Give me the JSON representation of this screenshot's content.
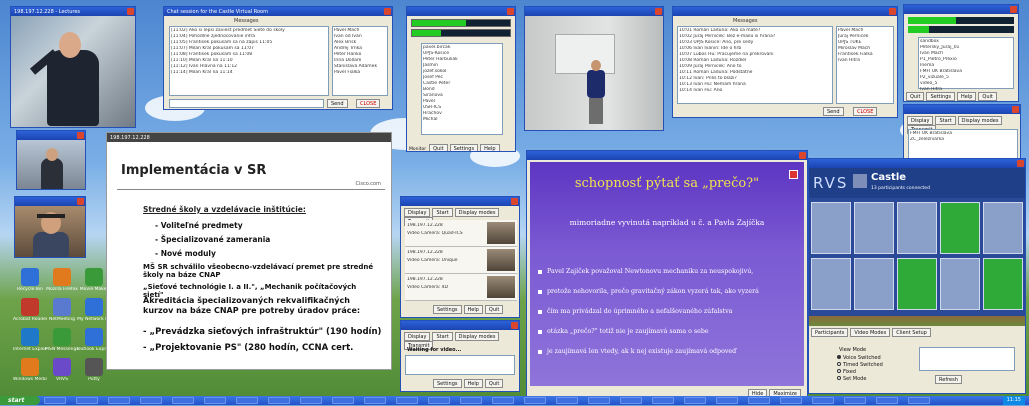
{
  "slide1": {
    "window_title": "198.197.12.228",
    "title": "Implementácia v SR",
    "brand": "Cisco.com",
    "heading1": "Stredné školy a vzdelávacie inštitúcie:",
    "bullets": [
      "- Voliteľné predmety",
      "- Špecializované zamerania",
      "- Nové moduly"
    ],
    "para1": "MŠ SR schválilo všeobecno-vzdelávací premet pre stredné školy na báze CNAP",
    "para2": "„Sieťové technológie I. a II.\", „Mechanik počítačových sietí\"",
    "para3": "Akreditácia špecializovaných rekvalifikačných kurzov na báze CNAP pre potreby úradov práce:",
    "course1": "- „Prevádzka sieťových infraštruktúr\" (190 hodín)",
    "course2": "- „Projektovanie PS\" (280 hodín, CCNA cert."
  },
  "slide2": {
    "title": "schopnosť pýtať sa „prečo?\"",
    "subtitle": "mimoriadne vyvinutá napríklad u č. a Pavla Zajíčka",
    "bullets": [
      "Pavel Zajíček považoval Newtonovu mechaniku za neuspokojivú,",
      "pretože nehovorila, prečo gravitačný zákon vyzerá tak, ako vyzerá",
      "čím ma privádzal do úprimného a nefalšovaného zúfalstva",
      "otázka „prečo?\" totiž nie je zaujímavá sama o sebe",
      "je zaujímavá len vtedy, ak k nej existuje zaujímavá odpoveď"
    ],
    "buttons": [
      "Hide",
      "Maximize"
    ]
  },
  "vrvs": {
    "logo": "RVS",
    "castle": "Castle",
    "participants": "13 participants connected",
    "tabs": [
      "Participants",
      "Video Modes",
      "Client Setup"
    ],
    "mode_label": "View Mode",
    "modes": [
      "Voice Switched",
      "Timed Switched",
      "Fixed",
      "Set Mode"
    ],
    "apply": "Refresh"
  },
  "chat": {
    "window_title": "Chat session for the Castle Virtual Room",
    "header": "Messages",
    "send": "Send",
    "close": "CLOSE",
    "messages": [
      "[11:02] Ako si lepsi zaviest predmet Siete do skoly",
      "[11:04] Pohodlne zjednocovanie infra",
      "[11:05] Frantisek pokusam sa na zapis 11:05",
      "[11:07] Milan Kral pokusam sa 11:07",
      "[11:08] Frantisek pokusam sa 11:08",
      "[11:10] Milan Kral na 11:10",
      "[11:12] Ivan Hlavna na 11:12",
      "[11:14] Milan Kral na 11:14"
    ],
    "people": [
      "Pavel Mach",
      "Ivan od Ivan",
      "Alex Brisk",
      "Andrej Trnka",
      "Peter Hanko",
      "Irina Dollam",
      "Stanislava Adamek",
      "Pavel Fialka"
    ]
  },
  "chat2": {
    "header": "Messages",
    "send": "Send",
    "close": "CLOSE",
    "messages": [
      "10:01 Roman Laduna: Ako sa mate?",
      "10:02 Juraj Pernicek: Bez e-mailu si hrana?",
      "10:03 UPJS Kosice: Ano, pre sedy",
      "10:06 Ivan Ivanin: Ide o hrb",
      "10:07 Lubos Hu: Pracujeme na prekrovani",
      "10:08 Roman Laduna: Rozdiel",
      "10:09 Juraj Pernicek: Ano to",
      "10:11 Roman Laduna: Podstatne",
      "10:12 Ivan: Prilis to blazi?",
      "10:13 Ivan Hu: Nemam hrana",
      "10:14 Ivan Hu: Ano"
    ],
    "people": [
      "Pavel Mach",
      "Juraj Pernicek",
      "UPJS TUKE",
      "Miroslav Mach",
      "Frantisek Fialka",
      "Ivan Hitra"
    ]
  },
  "list1": {
    "items": [
      "pavel.bircak",
      "UPJS-Kosice",
      "Peter Harbuliak",
      "Jasmin",
      "jozef.sokol",
      "Josef Pec",
      "Castle Peter",
      "Bond",
      "Siranova",
      "Pavel",
      "USR-ICS",
      "Hrachov",
      "Michal"
    ],
    "buttons": [
      "Quit",
      "Settings",
      "Help",
      "Quit"
    ],
    "checkbox": "Monitor"
  },
  "list2": {
    "items": [
      "sandbox",
      "Petersky_Juraj_01",
      "Ivan Mach",
      "P1_Pietro_Prexio",
      "Inema",
      "FMFI UK Bratislava",
      "P2_vizuale_5",
      "video_5",
      "Ivan Hitra"
    ],
    "buttons": [
      "Quit",
      "Settings",
      "Help",
      "Quit"
    ]
  },
  "panel": {
    "tabs": [
      "Display",
      "Start",
      "Display modes",
      "Transmit"
    ],
    "rows": [
      {
        "ip": "198.197.12.228",
        "info": "Video Camera: Quad-ICS"
      },
      {
        "ip": "198.197.12.228",
        "info": "Video Camera: Unique"
      },
      {
        "ip": "198.197.12.228",
        "info": "Video Camera: 4D"
      }
    ],
    "buttons": [
      "Settings",
      "Help",
      "Quit"
    ],
    "waiting": "Waiting for video..."
  },
  "panel2": {
    "items": [
      "FMFI UK Bratislava",
      "ZC_zelezniarka"
    ],
    "buttons": [
      "Settings",
      "Help",
      "Quit"
    ]
  },
  "misc": {
    "lecturer_title": "198.197.12.228 - Lectures"
  },
  "icons": [
    {
      "label": "Recycle Bin"
    },
    {
      "label": "Mozilla Firefox"
    },
    {
      "label": "Movie Maker"
    },
    {
      "label": "Acrobat Reader"
    },
    {
      "label": "NetMeeting"
    },
    {
      "label": "My Network Places"
    },
    {
      "label": "Internet Explorer"
    },
    {
      "label": "MSN Messenger"
    },
    {
      "label": "Outlook Express"
    },
    {
      "label": "Windows Media"
    },
    {
      "label": "VRVS"
    },
    {
      "label": "Putty"
    }
  ],
  "taskbar": {
    "start": "start",
    "clock": "11:15"
  },
  "colors": {
    "titlebar": "#1b44b2",
    "slide2_bg": "#6b46c8",
    "slide2_title": "#f2e24e",
    "vrvs_bg": "#1f3f88",
    "tile_green": "#2faa38"
  }
}
